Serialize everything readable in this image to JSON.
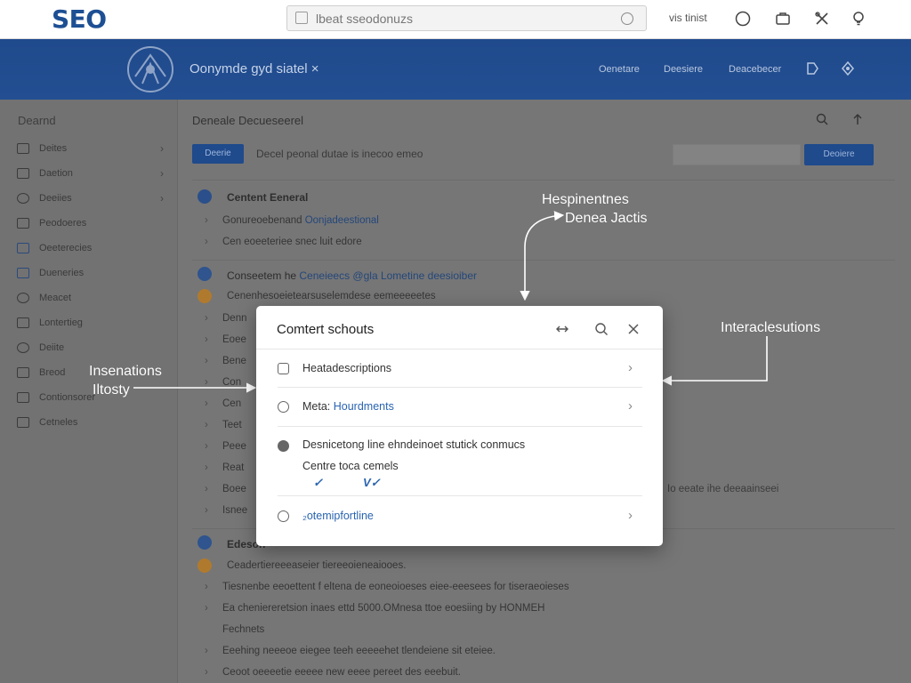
{
  "app": {
    "logo": "SEO",
    "search": {
      "value": "lbeat sseodonuzs"
    },
    "user_label": "vis tinist"
  },
  "header": {
    "title": "Oonymde gyd siatel ×",
    "nav": [
      "Oenetare",
      "Deesiere",
      "Deacebecer"
    ]
  },
  "sidebar": {
    "title": "Dearnd",
    "items": [
      {
        "label": "Deites",
        "chevron": true
      },
      {
        "label": "Daetion",
        "chevron": true
      },
      {
        "label": "Deeiies",
        "chevron": true
      },
      {
        "label": "Peodoeres",
        "chevron": false
      },
      {
        "label": "Oeeterecies",
        "chevron": false
      },
      {
        "label": "Dueneries",
        "chevron": false
      },
      {
        "label": "Meacet",
        "chevron": false
      },
      {
        "label": "Lontertieg",
        "chevron": false
      },
      {
        "label": "Deiite",
        "chevron": false
      },
      {
        "label": "Breod",
        "chevron": false
      },
      {
        "label": "Contionsorer",
        "chevron": false
      },
      {
        "label": "Cetneles",
        "chevron": false
      }
    ]
  },
  "main": {
    "title": "Deneale Decueseerel",
    "toolbar": {
      "button": "Deerie",
      "text": "Decel peonal dutae is inecoo emeo",
      "button2": "Deoiere"
    },
    "section1": {
      "heading": "Centent Eeneral",
      "rows": [
        {
          "text": "Gonureoebenand ",
          "link": "Oonjadeestional"
        },
        {
          "text": "Cen eoeeteriee snec luit edore",
          "link": ""
        }
      ]
    },
    "section2": {
      "heading": "Conseetem he ",
      "heading_link": "Ceneieecs @gla Lometine deesioiber",
      "subheading": "Cenenhesoeietearsuselemdese eemeeeeetes",
      "rows": [
        "Denn",
        "Eoee",
        "Bene",
        "Con",
        "Cen",
        "Teet",
        "Peee",
        "Reat",
        "Boee",
        "Isnee"
      ],
      "right_text": "Io eeate ihe deeaainseei"
    },
    "section3": {
      "heading": "Edeson",
      "subheading": "Ceadertiereeeaseier tiereeoieneaiooes.",
      "rows": [
        "Tiesnenbe eeoettent f eltena de eoneoioeses eiee-eeesees for tiseraeoieses",
        "Ea cheniereretsion inaes ettd 5000.OMnesa ttoe eoesiing by HONMEH",
        "Fechnets",
        "Eeehing neeeoe eiegee teeh eeeeehet tlendeiene sit eteiee.",
        "Ceoot oeeeetie eeeee new eeee pereet des eeebuit."
      ]
    }
  },
  "modal": {
    "title": "Comtert schouts",
    "rows": [
      {
        "label": "Heatadescriptions",
        "blue": ""
      },
      {
        "label": "Meta: ",
        "blue": "Hourdments"
      },
      {
        "label": "Desnicetong line ehndeinoet stutick conmucs",
        "blue": ""
      },
      {
        "label": "",
        "blue": "₂otemipfortline"
      }
    ],
    "subline": "Centre toca cemels",
    "checks": [
      "✓",
      "V✓"
    ]
  },
  "annotations": {
    "top": [
      "Hespinentnes",
      "Denea Jactis"
    ],
    "left": [
      "Insenations",
      "Iltosty"
    ],
    "right": "Interaclesutions"
  }
}
